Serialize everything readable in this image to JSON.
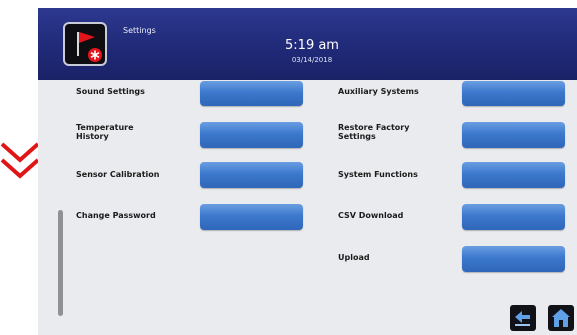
{
  "header": {
    "title": "Settings",
    "time": "5:19 am",
    "date": "03/14/2018",
    "icon": "flag-alarm-icon"
  },
  "left_items": [
    {
      "label": "Sound Settings"
    },
    {
      "label": "Temperature History"
    },
    {
      "label": "Sensor Calibration"
    },
    {
      "label": "Change Password"
    }
  ],
  "right_items": [
    {
      "label": "Auxiliary Systems"
    },
    {
      "label": "Restore Factory Settings"
    },
    {
      "label": "System Functions"
    },
    {
      "label": "CSV Download"
    },
    {
      "label": "Upload"
    }
  ],
  "nav": {
    "back_icon": "back-arrow-icon",
    "home_icon": "home-icon"
  },
  "colors": {
    "header": "#202a78",
    "button": "#3c78cc",
    "chevron": "#e01515"
  }
}
